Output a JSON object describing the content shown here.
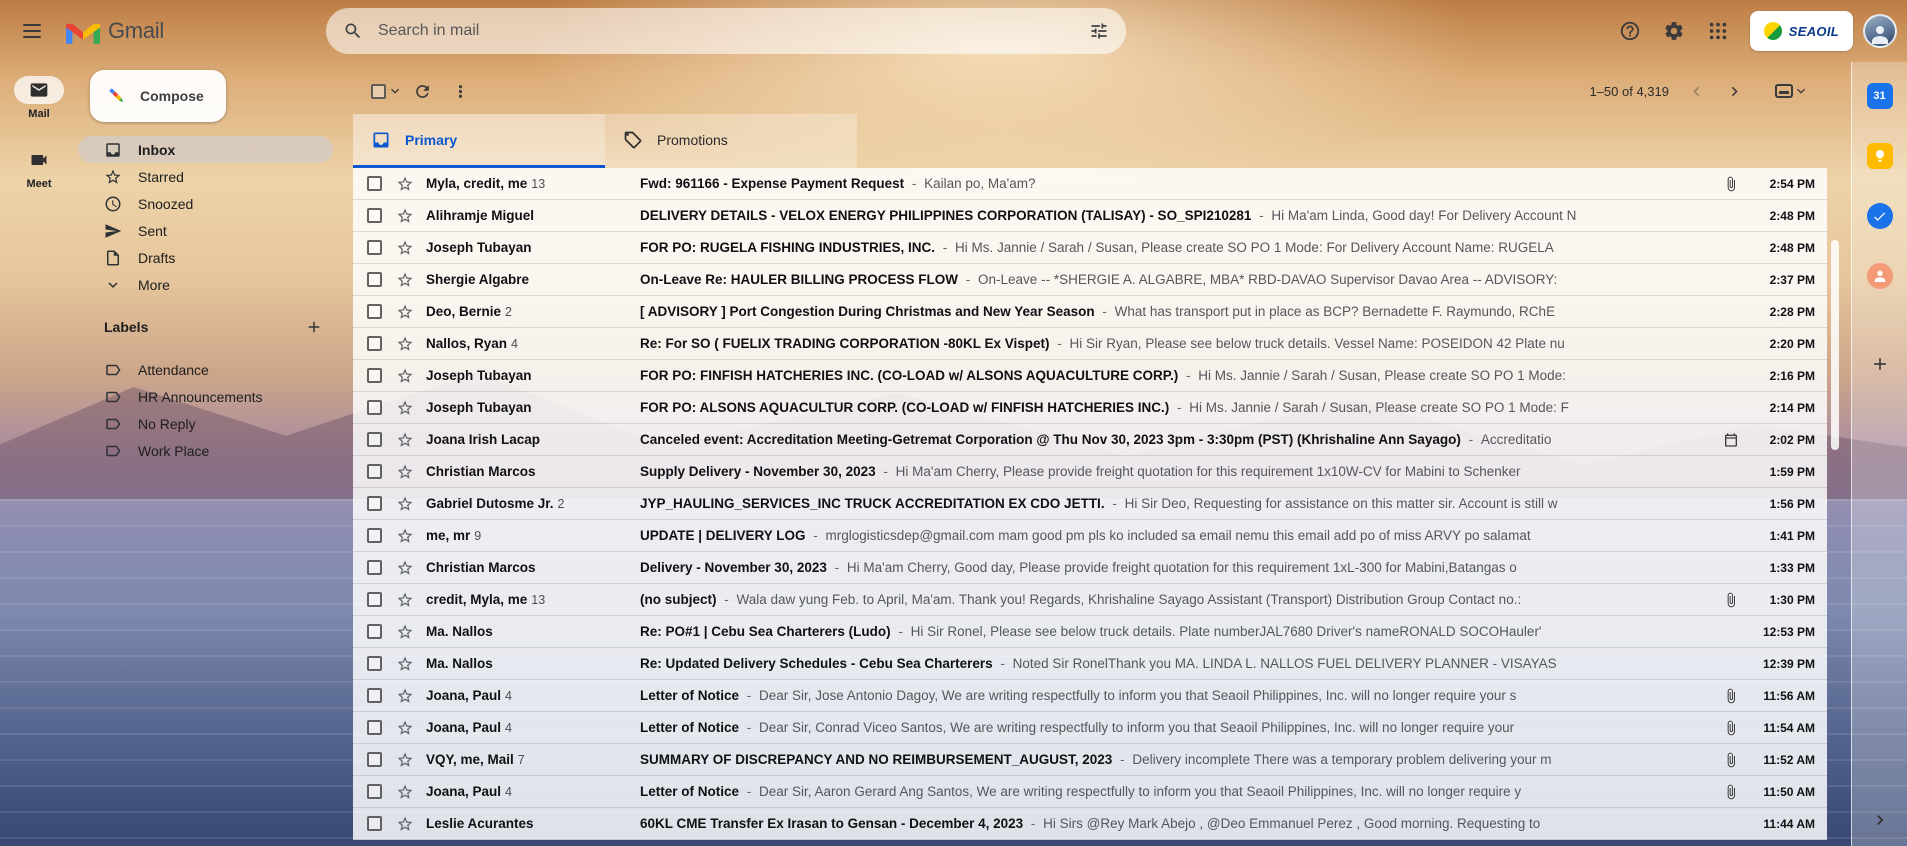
{
  "header": {
    "product": "Gmail",
    "search": {
      "placeholder": "Search in mail"
    },
    "brand_badge": "SEAOIL"
  },
  "rail": {
    "mail_label": "Mail",
    "meet_label": "Meet"
  },
  "sidebar": {
    "compose_label": "Compose",
    "items": [
      {
        "label": "Inbox",
        "active": true
      },
      {
        "label": "Starred",
        "active": false
      },
      {
        "label": "Snoozed",
        "active": false
      },
      {
        "label": "Sent",
        "active": false
      },
      {
        "label": "Drafts",
        "active": false
      },
      {
        "label": "More",
        "active": false
      }
    ],
    "labels_title": "Labels",
    "labels": [
      {
        "label": "Attendance"
      },
      {
        "label": "HR Announcements"
      },
      {
        "label": "No Reply"
      },
      {
        "label": "Work Place"
      }
    ]
  },
  "toolbar": {
    "pagination": "1–50 of 4,319"
  },
  "tabs": [
    {
      "label": "Primary",
      "active": true
    },
    {
      "label": "Promotions",
      "active": false
    }
  ],
  "list": {
    "separator": "-"
  },
  "emails": [
    {
      "sender": "Myla, credit, me",
      "count": "13",
      "subject": "Fwd: 961166 - Expense Payment Request",
      "snippet": "Kailan po, Ma'am?",
      "time": "2:54 PM",
      "has_attachment": true
    },
    {
      "sender": "Alihramje Miguel",
      "count": "",
      "subject": "DELIVERY DETAILS - VELOX ENERGY PHILIPPINES CORPORATION (TALISAY) - SO_SPI210281",
      "snippet": "Hi Ma'am Linda, Good day! For Delivery Account N",
      "time": "2:48 PM"
    },
    {
      "sender": "Joseph Tubayan",
      "count": "",
      "subject": "FOR PO: RUGELA FISHING INDUSTRIES, INC.",
      "snippet": "Hi Ms. Jannie / Sarah / Susan, Please create SO PO 1 Mode: For Delivery Account Name: RUGELA",
      "time": "2:48 PM"
    },
    {
      "sender": "Shergie Algabre",
      "count": "",
      "subject": "On-Leave Re: HAULER BILLING PROCESS FLOW",
      "snippet": "On-Leave -- *SHERGIE A. ALGABRE, MBA* RBD-DAVAO Supervisor Davao Area -- ADVISORY:",
      "time": "2:37 PM"
    },
    {
      "sender": "Deo, Bernie",
      "count": "2",
      "subject": "[ ADVISORY ] Port Congestion During Christmas and New Year Season",
      "snippet": "What has transport put in place as BCP? Bernadette F. Raymundo, RChE",
      "time": "2:28 PM"
    },
    {
      "sender": "Nallos, Ryan",
      "count": "4",
      "subject": "Re: For SO ( FUELIX TRADING CORPORATION -80KL Ex Vispet)",
      "snippet": "Hi Sir Ryan, Please see below truck details. Vessel Name: POSEIDON 42 Plate nu",
      "time": "2:20 PM"
    },
    {
      "sender": "Joseph Tubayan",
      "count": "",
      "subject": "FOR PO: FINFISH HATCHERIES INC. (CO-LOAD w/ ALSONS AQUACULTURE CORP.)",
      "snippet": "Hi Ms. Jannie / Sarah / Susan, Please create SO PO 1 Mode:",
      "time": "2:16 PM"
    },
    {
      "sender": "Joseph Tubayan",
      "count": "",
      "subject": "FOR PO: ALSONS AQUACULTUR CORP. (CO-LOAD w/ FINFISH HATCHERIES INC.)",
      "snippet": "Hi Ms. Jannie / Sarah / Susan, Please create SO PO 1 Mode: F",
      "time": "2:14 PM"
    },
    {
      "sender": "Joana Irish Lacap",
      "count": "",
      "subject": "Canceled event: Accreditation Meeting-Getremat Corporation @ Thu Nov 30, 2023 3pm - 3:30pm (PST) (Khrishaline Ann Sayago)",
      "snippet": "Accreditatio",
      "time": "2:02 PM",
      "has_calendar": true
    },
    {
      "sender": "Christian Marcos",
      "count": "",
      "subject": "Supply Delivery - November 30, 2023",
      "snippet": "Hi Ma'am Cherry, Please provide freight quotation for this requirement 1x10W-CV for Mabini to Schenker",
      "time": "1:59 PM"
    },
    {
      "sender": "Gabriel Dutosme Jr.",
      "count": "2",
      "subject": "JYP_HAULING_SERVICES_INC TRUCK ACCREDITATION EX CDO JETTI.",
      "snippet": "Hi Sir Deo, Requesting for assistance on this matter sir. Account is still w",
      "time": "1:56 PM"
    },
    {
      "sender": "me, mr",
      "count": "9",
      "subject": "UPDATE | DELIVERY LOG",
      "snippet": "mrglogisticsdep@gmail.com mam good pm pls ko included sa email nemu this email add po of miss ARVY po salamat",
      "time": "1:41 PM"
    },
    {
      "sender": "Christian Marcos",
      "count": "",
      "subject": "Delivery - November 30, 2023",
      "snippet": "Hi Ma'am Cherry, Good day, Please provide freight quotation for this requirement 1xL-300 for Mabini,Batangas o",
      "time": "1:33 PM"
    },
    {
      "sender": "credit, Myla, me",
      "count": "13",
      "subject": "(no subject)",
      "snippet": "Wala daw yung Feb. to April, Ma'am. Thank you! Regards, Khrishaline Sayago Assistant (Transport) Distribution Group Contact no.:",
      "time": "1:30 PM",
      "has_attachment": true
    },
    {
      "sender": "Ma. Nallos",
      "count": "",
      "subject": "Re: PO#1 | Cebu Sea Charterers (Ludo)",
      "snippet": "Hi Sir Ronel, Please see below truck details. Plate numberJAL7680 Driver's nameRONALD SOCOHauler'",
      "time": "12:53 PM"
    },
    {
      "sender": "Ma. Nallos",
      "count": "",
      "subject": "Re: Updated Delivery Schedules - Cebu Sea Charterers",
      "snippet": "Noted Sir RonelThank you MA. LINDA L. NALLOS FUEL DELIVERY PLANNER - VISAYAS",
      "time": "12:39 PM"
    },
    {
      "sender": "Joana, Paul",
      "count": "4",
      "subject": "Letter of Notice",
      "snippet": "Dear Sir, Jose Antonio Dagoy, We are writing respectfully to inform you that Seaoil Philippines, Inc. will no longer require your s",
      "time": "11:56 AM",
      "has_attachment": true
    },
    {
      "sender": "Joana, Paul",
      "count": "4",
      "subject": "Letter of Notice",
      "snippet": "Dear Sir, Conrad Viceo Santos, We are writing respectfully to inform you that Seaoil Philippines, Inc. will no longer require your",
      "time": "11:54 AM",
      "has_attachment": true
    },
    {
      "sender": "VQY, me, Mail",
      "count": "7",
      "subject": "SUMMARY OF DISCREPANCY AND NO REIMBURSEMENT_AUGUST, 2023",
      "snippet": "Delivery incomplete There was a temporary problem delivering your m",
      "time": "11:52 AM",
      "has_attachment": true
    },
    {
      "sender": "Joana, Paul",
      "count": "4",
      "subject": "Letter of Notice",
      "snippet": "Dear Sir, Aaron Gerard Ang Santos, We are writing respectfully to inform you that Seaoil Philippines, Inc. will no longer require y",
      "time": "11:50 AM",
      "has_attachment": true
    },
    {
      "sender": "Leslie Acurantes",
      "count": "",
      "subject": "60KL CME Transfer Ex Irasan to Gensan - December 4, 2023",
      "snippet": "Hi Sirs @Rey Mark Abejo , @Deo Emmanuel Perez , Good morning. Requesting to",
      "time": "11:44 AM"
    }
  ],
  "side_panel": {
    "calendar_label": "31"
  },
  "colors": {
    "tab_active_blue": "#0b57d0",
    "google_blue": "#4285f4",
    "google_red": "#ea4335",
    "google_yellow": "#fbbc04",
    "google_green": "#34a853",
    "selected_item_bg": "rgba(214,203,192,0.88)"
  }
}
